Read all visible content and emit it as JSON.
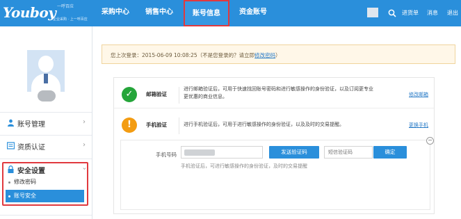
{
  "header": {
    "logo_text": "Youboy",
    "logo_top": "一呼百应",
    "logo_sub": "企业采购 · 上一呼百应",
    "nav": [
      "采购中心",
      "销售中心",
      "账号信息",
      "资金账号"
    ],
    "active_nav": "账号信息",
    "links": [
      "进货单",
      "消息",
      "退出"
    ]
  },
  "sidebar": {
    "items": [
      {
        "label": "账号管理",
        "icon": "user-icon"
      },
      {
        "label": "资质认证",
        "icon": "certificate-icon"
      },
      {
        "label": "安全设置",
        "icon": "lock-icon"
      }
    ],
    "sub_items": [
      "修改密码",
      "账号安全"
    ],
    "active_sub": "账号安全"
  },
  "notice": {
    "text": "您上次登录：2015-06-09 10:08:25（不是您登录的？请立即",
    "link": "修改密码",
    "suffix": "）"
  },
  "security": {
    "email": {
      "title": "邮箱验证",
      "desc1": "进行邮箱验证后，可用于快速找回账号密码和进行敏感操作的身份验证，以及订阅更专业",
      "desc2": "更优惠的商业信息。",
      "link": "修改邮箱",
      "status_color": "#25a53a"
    },
    "phone": {
      "title": "手机验证",
      "desc": "进行手机验证后，可用于进行敏感操作的身份验证，以及及时的交易提醒。",
      "link": "更换手机",
      "status_color": "#f39c12"
    },
    "phone_form": {
      "label": "手机号码",
      "send_button": "发送验证码",
      "code_placeholder": "短信验证码",
      "confirm_button": "确定",
      "hint": "手机验证后，可进行敏感操作的身份验证，及时的交易提醒",
      "collapse": "−"
    }
  },
  "colors": {
    "brand": "#2a8fdb",
    "highlight": "#e0393e"
  }
}
